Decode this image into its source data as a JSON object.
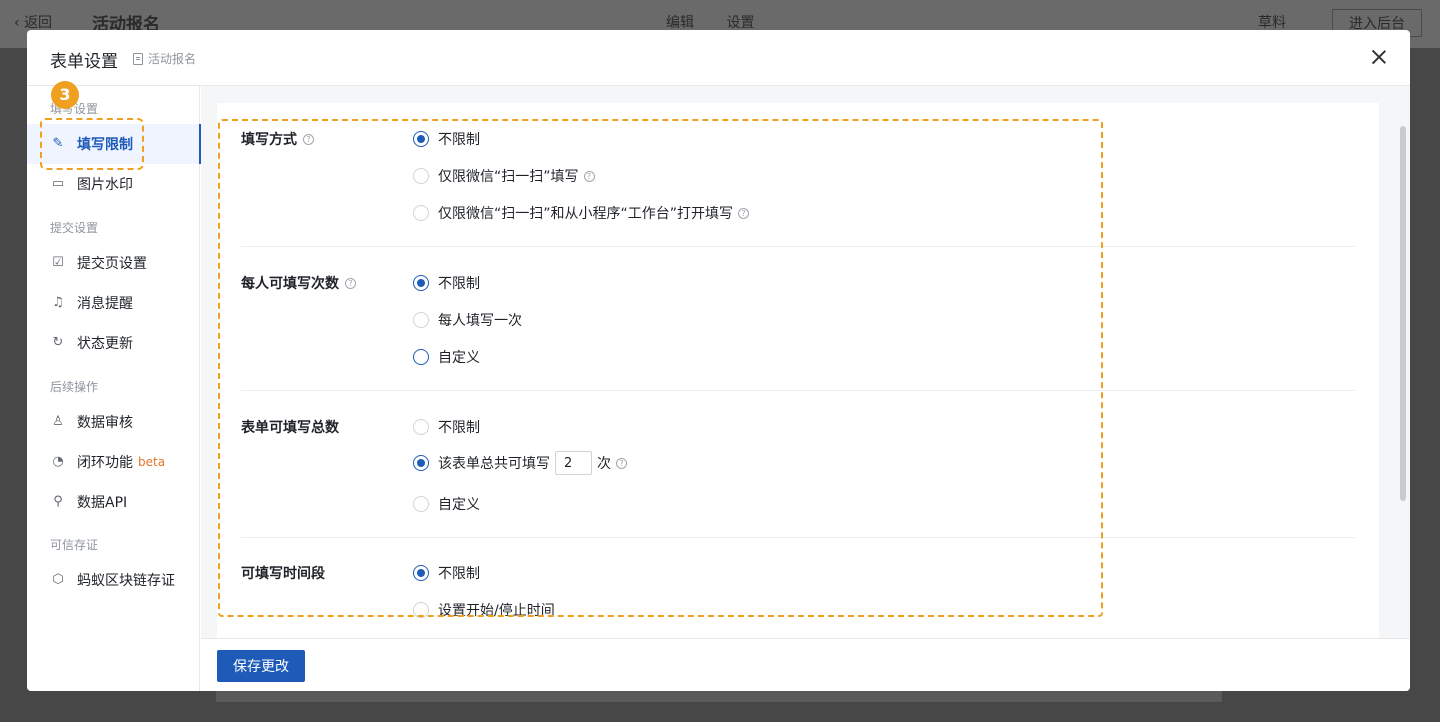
{
  "background": {
    "back_label": "返回",
    "title": "活动报名",
    "tabs": [
      "编辑",
      "设置"
    ],
    "draft_label": "草料",
    "enter_backend": "进入后台"
  },
  "modal": {
    "title": "表单设置",
    "subtitle": "活动报名",
    "step_number": "3"
  },
  "sidebar": {
    "group1": "填写设置",
    "group2": "提交设置",
    "group3": "后续操作",
    "group4": "可信存证",
    "items": [
      {
        "label": "填写限制",
        "icon": "pen-icon"
      },
      {
        "label": "图片水印",
        "icon": "image-icon"
      },
      {
        "label": "提交页设置",
        "icon": "checklist-icon"
      },
      {
        "label": "消息提醒",
        "icon": "bell-icon"
      },
      {
        "label": "状态更新",
        "icon": "refresh-icon"
      },
      {
        "label": "数据审核",
        "icon": "stamp-icon"
      },
      {
        "label": "闭环功能",
        "icon": "loop-icon",
        "badge": "beta"
      },
      {
        "label": "数据API",
        "icon": "link-icon"
      },
      {
        "label": "蚂蚁区块链存证",
        "icon": "blockchain-icon"
      }
    ]
  },
  "sections": {
    "fill_method": {
      "label": "填写方式",
      "options": [
        "不限制",
        "仅限微信“扫一扫”填写",
        "仅限微信“扫一扫”和从小程序“工作台”打开填写"
      ]
    },
    "per_person": {
      "label": "每人可填写次数",
      "options": [
        "不限制",
        "每人填写一次",
        "自定义"
      ]
    },
    "total": {
      "label": "表单可填写总数",
      "options": [
        "不限制",
        "该表单总共可填写",
        "自定义"
      ],
      "count_value": "2",
      "count_unit": "次"
    },
    "time_range": {
      "label": "可填写时间段",
      "options": [
        "不限制",
        "设置开始/停止时间"
      ]
    }
  },
  "footer": {
    "save_label": "保存更改"
  }
}
